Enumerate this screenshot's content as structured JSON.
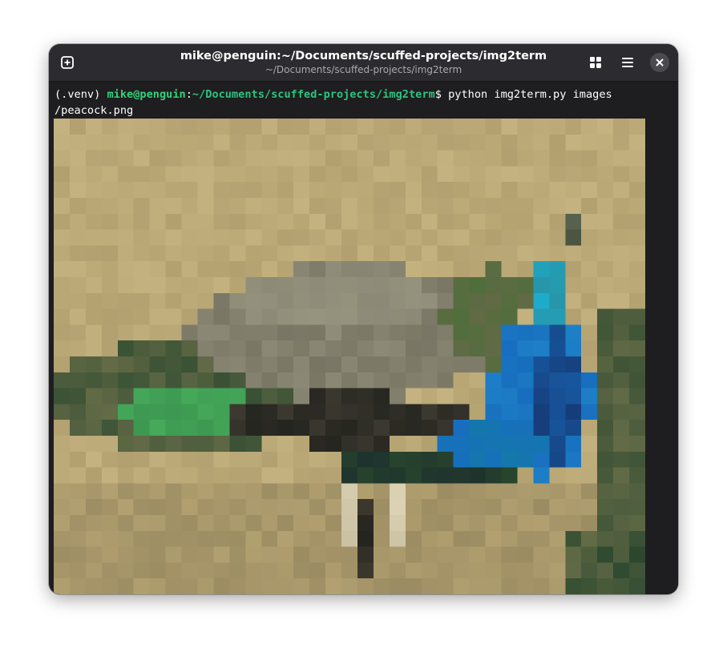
{
  "window": {
    "title": "mike@penguin:~/Documents/scuffed-projects/img2term",
    "subtitle": "~/Documents/scuffed-projects/img2term"
  },
  "titlebar": {
    "left_icon": "new-tab-icon",
    "right_icons": [
      "grid-view-icon",
      "hamburger-menu-icon",
      "close-icon"
    ]
  },
  "terminal": {
    "venv": "(.venv) ",
    "user_host": "mike@penguin",
    "colon": ":",
    "path": "~/Documents/scuffed-projects/img2term",
    "prompt_symbol": "$ ",
    "command": "python img2term.py images",
    "command_wrap": "/peacock.png",
    "output_image": "peacock-pixel-art",
    "colors": {
      "background": "#1e1e20",
      "text": "#ffffff",
      "prompt_user": "#33d17a",
      "prompt_path": "#2ec27e"
    }
  }
}
